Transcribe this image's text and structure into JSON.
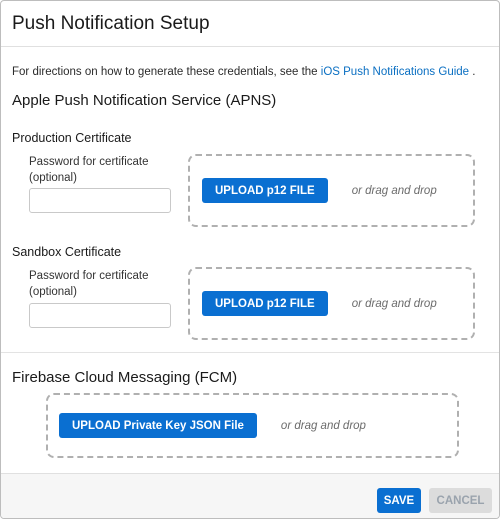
{
  "modal": {
    "title": "Push Notification Setup"
  },
  "intro": {
    "text": "For directions on how to generate these credentials, see the ",
    "link_label": "iOS Push Notifications Guide",
    "suffix": " ."
  },
  "apns": {
    "title": "Apple Push Notification Service (APNS)",
    "production": {
      "title": "Production Certificate",
      "password_label": "Password for certificate (optional)",
      "password_value": "",
      "upload_label": "UPLOAD p12 FILE",
      "drag_text": "or drag and drop"
    },
    "sandbox": {
      "title": "Sandbox Certificate",
      "password_label": "Password for certificate (optional)",
      "password_value": "",
      "upload_label": "UPLOAD p12 FILE",
      "drag_text": "or drag and drop"
    }
  },
  "fcm": {
    "title": "Firebase Cloud Messaging (FCM)",
    "upload_label": "UPLOAD Private Key JSON File",
    "drag_text": "or drag and drop"
  },
  "footer": {
    "save_label": "SAVE",
    "cancel_label": "CANCEL"
  },
  "colors": {
    "primary": "#0a6fd1",
    "link": "#0a6fc2",
    "disabled_bg": "#dcdcdc"
  }
}
